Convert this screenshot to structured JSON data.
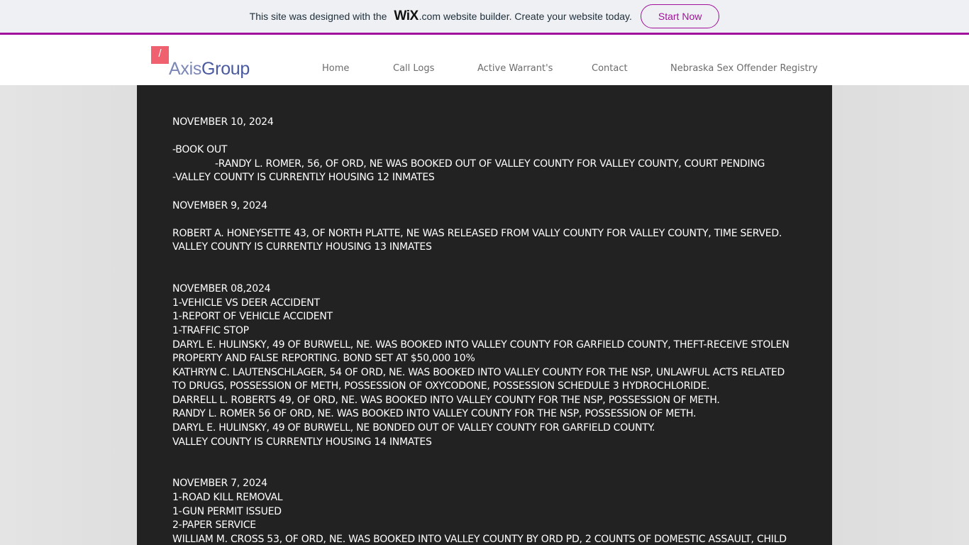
{
  "banner": {
    "text_before": "This site was designed with the",
    "wix": "WiX",
    "dotcom": ".com",
    "text_after": "website builder. Create your website today.",
    "cta": "Start Now",
    "accent": "#a0129c"
  },
  "header": {
    "logo_mark": "/",
    "logo_axis": "Axis",
    "logo_group": "Group",
    "nav": [
      {
        "label": "Home"
      },
      {
        "label": "Call Logs"
      },
      {
        "label": "Active Warrant's"
      },
      {
        "label": "Contact"
      },
      {
        "label": "Nebraska Sex Offender Registry"
      }
    ]
  },
  "feed": {
    "lines": [
      {
        "text": "NOVEMBER 10, 2024"
      },
      {
        "text": ""
      },
      {
        "text": "-BOOK OUT"
      },
      {
        "text": "-RANDY L. ROMER, 56, OF ORD, NE WAS BOOKED OUT OF VALLEY COUNTY FOR VALLEY COUNTY, COURT PENDING",
        "indent": true
      },
      {
        "text": "-VALLEY COUNTY IS CURRENTLY HOUSING 12 INMATES"
      },
      {
        "text": ""
      },
      {
        "text": "NOVEMBER 9, 2024"
      },
      {
        "text": ""
      },
      {
        "text": "ROBERT A. HONEYSETTE 43, OF NORTH PLATTE, NE WAS RELEASED FROM VALLY COUNTY FOR VALLEY COUNTY, TIME SERVED."
      },
      {
        "text": "VALLEY COUNTY IS CURRENTLY HOUSING 13 INMATES"
      },
      {
        "text": ""
      },
      {
        "text": ""
      },
      {
        "text": "NOVEMBER 08,2024"
      },
      {
        "text": "1-VEHICLE VS DEER ACCIDENT"
      },
      {
        "text": "1-REPORT OF VEHICLE ACCIDENT"
      },
      {
        "text": "1-TRAFFIC STOP"
      },
      {
        "text": "DARYL E. HULINSKY, 49 OF BURWELL, NE. WAS BOOKED INTO VALLEY COUNTY FOR GARFIELD COUNTY, THEFT-RECEIVE STOLEN PROPERTY AND FALSE REPORTING. BOND SET AT $50,000 10%"
      },
      {
        "text": "KATHRYN C. LAUTENSCHLAGER, 54 OF ORD, NE. WAS BOOKED INTO VALLEY COUNTY FOR THE NSP, UNLAWFUL ACTS RELATED TO DRUGS, POSSESSION OF METH, POSSESSION OF OXYCODONE, POSSESSION SCHEDULE 3 HYDROCHLORIDE."
      },
      {
        "text": "DARRELL L. ROBERTS 49, OF ORD, NE. WAS BOOKED INTO VALLEY COUNTY FOR THE NSP, POSSESSION OF METH."
      },
      {
        "text": "RANDY L. ROMER 56 OF ORD, NE. WAS BOOKED INTO VALLEY COUNTY FOR THE NSP, POSSESSION OF METH."
      },
      {
        "text": "DARYL E. HULINSKY, 49 OF BURWELL, NE BONDED OUT OF VALLEY COUNTY FOR GARFIELD COUNTY."
      },
      {
        "text": "VALLEY COUNTY IS CURRENTLY HOUSING 14 INMATES"
      },
      {
        "text": ""
      },
      {
        "text": ""
      },
      {
        "text": "NOVEMBER 7, 2024"
      },
      {
        "text": "1-ROAD KILL REMOVAL"
      },
      {
        "text": "1-GUN PERMIT ISSUED"
      },
      {
        "text": "2-PAPER SERVICE"
      },
      {
        "text": "WILLIAM M. CROSS 53, OF ORD, NE. WAS BOOKED INTO VALLEY COUNTY BY ORD PD, 2 COUNTS OF DOMESTIC ASSAULT, CHILD"
      }
    ]
  }
}
